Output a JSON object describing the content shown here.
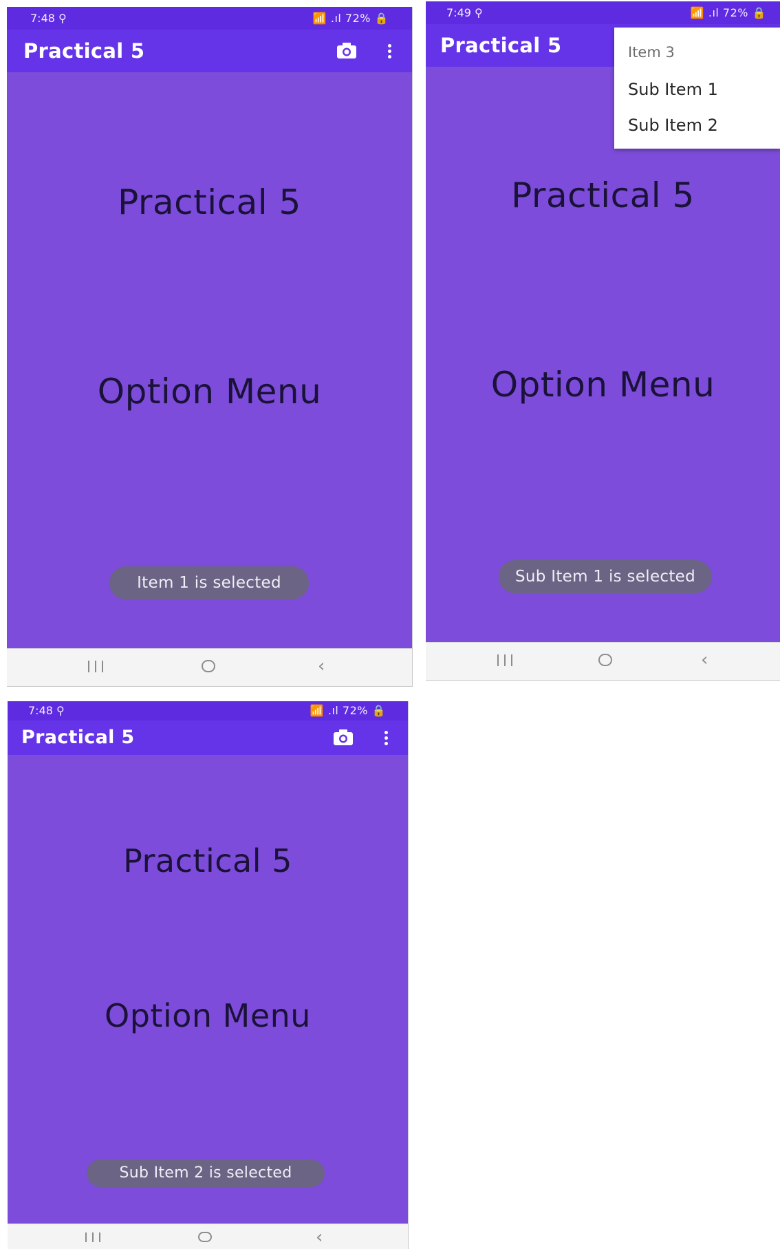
{
  "screens": [
    {
      "status_time": "7:48 ⚲",
      "status_icons": "📶 ⁢.ıl 72% 🔒",
      "app_title": "Practical 5",
      "heading": "Practical 5",
      "subheading": "Option Menu",
      "toast": "Item 1 is selected",
      "action_icons": [
        "camera-icon",
        "overflow-menu-icon"
      ]
    },
    {
      "status_time": "7:49 ⚲",
      "status_icons": "📶 ⁢.ıl 72% 🔒",
      "app_title": "Practical 5",
      "heading": "Practical 5",
      "subheading": "Option Menu",
      "toast": "Sub Item 1 is selected",
      "popup_menu": {
        "header": "Item 3",
        "items": [
          "Sub Item 1",
          "Sub Item 2"
        ]
      }
    },
    {
      "status_time": "7:48 ⚲",
      "status_icons": "📶 ⁢.ıl 72% 🔒",
      "app_title": "Practical 5",
      "heading": "Practical 5",
      "subheading": "Option Menu",
      "toast": "Sub Item 2 is selected",
      "action_icons": [
        "camera-icon",
        "overflow-menu-icon"
      ]
    }
  ],
  "nav_icons": [
    "recents-icon",
    "home-icon",
    "back-icon"
  ],
  "colors": {
    "background": "#7d4cda",
    "app_bar": "#6534e8",
    "status_bar": "#5f2be0",
    "toast": "#6b6485",
    "nav_bar": "#f4f4f5"
  }
}
